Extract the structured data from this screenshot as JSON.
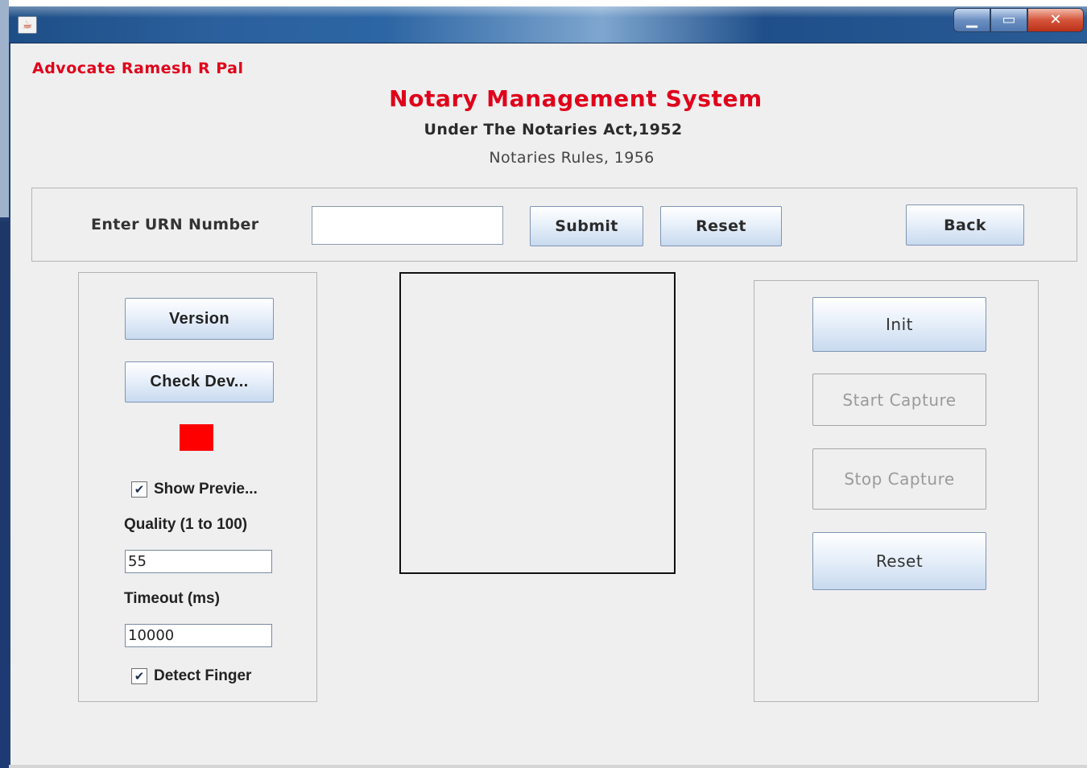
{
  "window": {
    "icon": "java-coffee-icon",
    "controls": {
      "minimize": "▁",
      "maximize": "▭",
      "close": "✕"
    }
  },
  "header": {
    "advocate": "Advocate Ramesh R Pal",
    "title": "Notary Management System",
    "subtitle": "Under The Notaries Act,1952",
    "rules": "Notaries Rules, 1956"
  },
  "urn": {
    "label": "Enter URN Number",
    "value": "",
    "submit_label": "Submit",
    "reset_label": "Reset",
    "back_label": "Back"
  },
  "left_panel": {
    "version_label": "Version",
    "check_device_label": "Check Dev...",
    "status_color": "#ff0000",
    "show_preview_label": "Show Previe...",
    "show_preview_checked": true,
    "quality_label": "Quality (1 to 100)",
    "quality_value": "55",
    "timeout_label": "Timeout (ms)",
    "timeout_value": "10000",
    "detect_finger_label": "Detect Finger",
    "detect_finger_checked": true
  },
  "right_panel": {
    "init_label": "Init",
    "start_capture_label": "Start Capture",
    "stop_capture_label": "Stop Capture",
    "reset_label": "Reset"
  },
  "colors": {
    "accent_red": "#e0001a",
    "window_bg": "#efefef"
  }
}
